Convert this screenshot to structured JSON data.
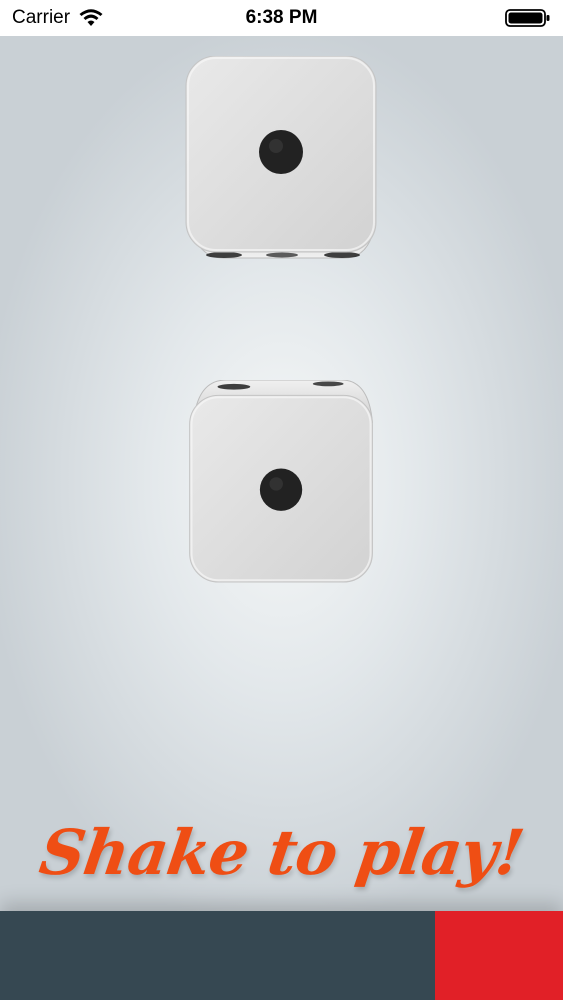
{
  "status_bar": {
    "carrier": "Carrier",
    "time": "6:38 PM",
    "icons": [
      "wifi-icon",
      "battery-icon"
    ]
  },
  "dice": [
    {
      "name": "die-top",
      "face_value": 1
    },
    {
      "name": "die-bottom",
      "face_value": 1
    }
  ],
  "prompt": {
    "text": "Shake to play!",
    "color": "#ef4e14"
  },
  "bottom_bar": {
    "dark_color": "#364852",
    "accent_color": "#e12027"
  }
}
